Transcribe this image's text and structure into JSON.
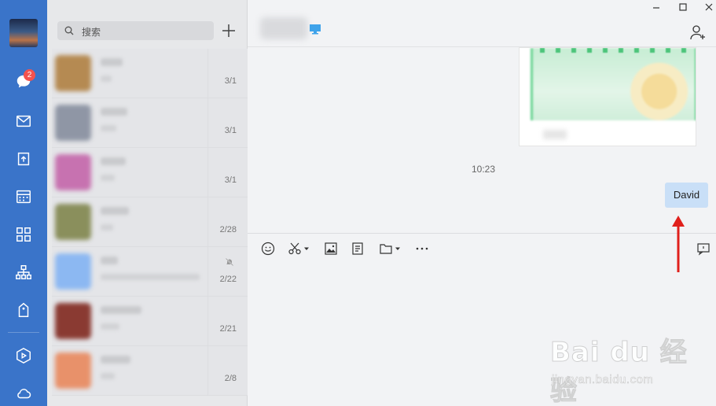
{
  "sidebar": {
    "unread_badge": "2",
    "items": [
      {
        "icon": "chat-icon"
      },
      {
        "icon": "mail-icon"
      },
      {
        "icon": "send-icon"
      },
      {
        "icon": "calendar-icon"
      },
      {
        "icon": "apps-icon"
      },
      {
        "icon": "org-chart-icon"
      },
      {
        "icon": "tag-icon"
      },
      {
        "icon": "cube-icon"
      },
      {
        "icon": "cloud-icon"
      }
    ]
  },
  "search": {
    "placeholder": "搜索"
  },
  "conversations": [
    {
      "date": "3/1",
      "avatar_color": "#b58a52"
    },
    {
      "date": "3/1",
      "avatar_color": "#8f96a5"
    },
    {
      "date": "3/1",
      "avatar_color": "#c772b0"
    },
    {
      "date": "2/28",
      "avatar_color": "#8a8f5c"
    },
    {
      "date": "2/22",
      "avatar_color": "#8cb8f2",
      "muted": true
    },
    {
      "date": "2/21",
      "avatar_color": "#8a3a32"
    },
    {
      "date": "2/8",
      "avatar_color": "#e8916a"
    }
  ],
  "chat": {
    "timestamp": "10:23",
    "last_message": "David"
  },
  "toolbar": {
    "icons": [
      "emoji-icon",
      "scissors-icon",
      "image-icon",
      "document-icon",
      "folder-icon",
      "more-icon"
    ]
  },
  "colors": {
    "rail": "#3a74c9",
    "bubble": "#c9dff7",
    "badge": "#f4524d",
    "arrow": "#e0201c"
  },
  "watermark": {
    "logo": "Bai du 经验",
    "url": "jingyan.baidu.com"
  }
}
